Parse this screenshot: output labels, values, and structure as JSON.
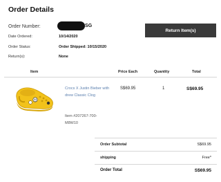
{
  "page": {
    "title": "Order Details"
  },
  "order": {
    "number_label": "Order Number:",
    "number_suffix": "CSG",
    "date_label": "Date Ordered:",
    "date_value": "10/14/2020",
    "status_label": "Order Status:",
    "status_value": "Order Shipped: 10/15/2020",
    "returns_label": "Return(s):",
    "returns_value": "None",
    "return_button_label": "Return Item(s)"
  },
  "table": {
    "headers": [
      "Item",
      "Price Each",
      "Quantity",
      "Total"
    ],
    "rows": [
      {
        "image_icon": "yellow-clog-image",
        "name": "Crocs X Justin Bieber with drew Classic Clog",
        "sku": "Item #207267-700-M8W10",
        "price_each": "S$69.95",
        "quantity": "1",
        "total": "S$69.95"
      }
    ]
  },
  "summary": {
    "subtotal_label": "Order Subtotal",
    "subtotal_value": "S$69.95",
    "shipping_label": "shipping",
    "shipping_value": "Free*",
    "total_label": "Order Total",
    "total_value": "S$69.95"
  },
  "colors": {
    "button_bg": "#3a3a3a",
    "link": "#5b7fae",
    "clog": "#f2c21b"
  }
}
